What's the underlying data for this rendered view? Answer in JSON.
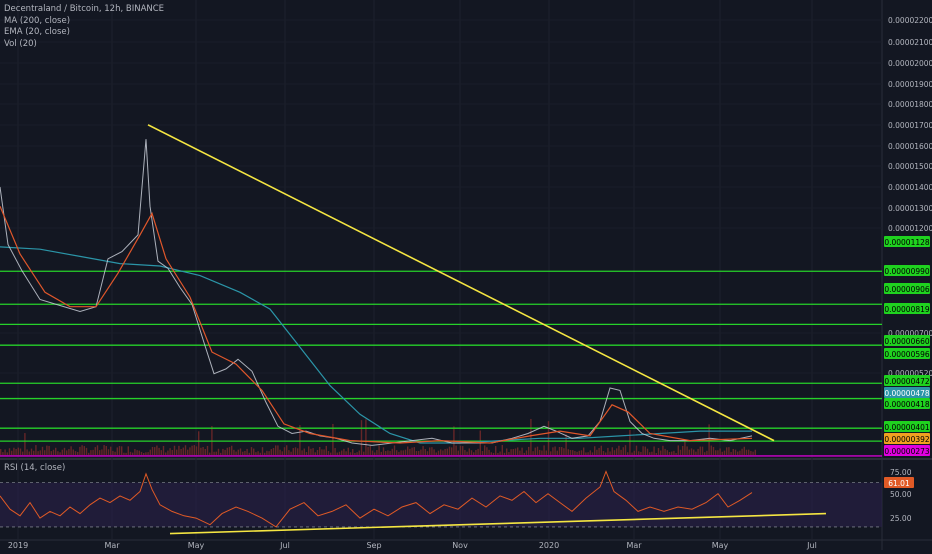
{
  "legend": {
    "title": "Decentraland / Bitcoin, 12h, BINANCE",
    "ma": "MA (200, close)",
    "ema": "EMA (20, close)",
    "vol": "Vol (20)",
    "rsi": "RSI (14, close)"
  },
  "colors": {
    "background": "#131722",
    "price_line": "#f2f2f2",
    "ema": "#e0572b",
    "ma": "#2b95a8",
    "trendline": "#f5e642",
    "support_lines": "#26d22a",
    "base_line": "#d000d0",
    "rsi_line": "#e05a26",
    "rsi_band": "#2a1f4a",
    "volume": "#7a2a2a"
  },
  "chart_data": [
    {
      "type": "line",
      "title": "Decentraland / Bitcoin, 12h, BINANCE",
      "x_tick_labels": [
        "2019",
        "Mar",
        "May",
        "Jul",
        "Sep",
        "Nov",
        "2020",
        "Mar",
        "May",
        "Jul"
      ],
      "y_tick_labels": [
        "0.00002200",
        "0.00002100",
        "0.00002000",
        "0.00001900",
        "0.00001800",
        "0.00001700",
        "0.00001600",
        "0.00001500",
        "0.00001400",
        "0.00001300",
        "0.00001200",
        "0.00000700",
        "0.00000520"
      ],
      "ylim": [
        3.6e-06,
        2.22e-05
      ],
      "price_path": [
        [
          0,
          1.48e-05
        ],
        [
          8,
          1.24e-05
        ],
        [
          22,
          1.13e-05
        ],
        [
          40,
          1.01e-05
        ],
        [
          60,
          9.85e-06
        ],
        [
          80,
          9.6e-06
        ],
        [
          96,
          9.8e-06
        ],
        [
          108,
          1.18e-05
        ],
        [
          122,
          1.21e-05
        ],
        [
          138,
          1.28e-05
        ],
        [
          146,
          1.68e-05
        ],
        [
          150,
          1.4e-05
        ],
        [
          158,
          1.17e-05
        ],
        [
          168,
          1.14e-05
        ],
        [
          180,
          1.06e-05
        ],
        [
          192,
          9.9e-06
        ],
        [
          204,
          8.3e-06
        ],
        [
          214,
          7e-06
        ],
        [
          226,
          7.2e-06
        ],
        [
          238,
          7.6e-06
        ],
        [
          252,
          7.1e-06
        ],
        [
          266,
          5.8e-06
        ],
        [
          278,
          4.8e-06
        ],
        [
          292,
          4.5e-06
        ],
        [
          306,
          4.6e-06
        ],
        [
          320,
          4.4e-06
        ],
        [
          336,
          4.3e-06
        ],
        [
          352,
          4.1e-06
        ],
        [
          372,
          4e-06
        ],
        [
          392,
          4.1e-06
        ],
        [
          412,
          4.2e-06
        ],
        [
          432,
          4.3e-06
        ],
        [
          452,
          4.1e-06
        ],
        [
          472,
          4.1e-06
        ],
        [
          492,
          4.1e-06
        ],
        [
          512,
          4.3e-06
        ],
        [
          528,
          4.5e-06
        ],
        [
          544,
          4.8e-06
        ],
        [
          556,
          4.6e-06
        ],
        [
          572,
          4.3e-06
        ],
        [
          588,
          4.4e-06
        ],
        [
          600,
          5e-06
        ],
        [
          610,
          6.4e-06
        ],
        [
          620,
          6.3e-06
        ],
        [
          630,
          5e-06
        ],
        [
          642,
          4.5e-06
        ],
        [
          654,
          4.3e-06
        ],
        [
          670,
          4.2e-06
        ],
        [
          690,
          4.2e-06
        ],
        [
          710,
          4.3e-06
        ],
        [
          730,
          4.2e-06
        ],
        [
          752,
          4.4e-06
        ]
      ],
      "ema_path": [
        [
          0,
          1.4e-05
        ],
        [
          20,
          1.2e-05
        ],
        [
          45,
          1.04e-05
        ],
        [
          70,
          9.8e-06
        ],
        [
          96,
          9.8e-06
        ],
        [
          118,
          1.12e-05
        ],
        [
          140,
          1.28e-05
        ],
        [
          152,
          1.37e-05
        ],
        [
          166,
          1.18e-05
        ],
        [
          190,
          1.02e-05
        ],
        [
          212,
          7.9e-06
        ],
        [
          236,
          7.4e-06
        ],
        [
          262,
          6.3e-06
        ],
        [
          284,
          4.9e-06
        ],
        [
          310,
          4.5e-06
        ],
        [
          350,
          4.2e-06
        ],
        [
          400,
          4.1e-06
        ],
        [
          440,
          4.2e-06
        ],
        [
          490,
          4.1e-06
        ],
        [
          530,
          4.4e-06
        ],
        [
          560,
          4.6e-06
        ],
        [
          590,
          4.4e-06
        ],
        [
          612,
          5.7e-06
        ],
        [
          628,
          5.4e-06
        ],
        [
          650,
          4.5e-06
        ],
        [
          690,
          4.2e-06
        ],
        [
          752,
          4.3e-06
        ]
      ],
      "ma_path": [
        [
          0,
          1.23e-05
        ],
        [
          40,
          1.22e-05
        ],
        [
          80,
          1.19e-05
        ],
        [
          120,
          1.16e-05
        ],
        [
          160,
          1.15e-05
        ],
        [
          200,
          1.11e-05
        ],
        [
          240,
          1.04e-05
        ],
        [
          270,
          9.7e-06
        ],
        [
          300,
          8.1e-06
        ],
        [
          330,
          6.5e-06
        ],
        [
          360,
          5.3e-06
        ],
        [
          390,
          4.5e-06
        ],
        [
          420,
          4.1e-06
        ],
        [
          460,
          4.1e-06
        ],
        [
          500,
          4.2e-06
        ],
        [
          540,
          4.3e-06
        ],
        [
          580,
          4.3e-06
        ],
        [
          620,
          4.4e-06
        ],
        [
          660,
          4.5e-06
        ],
        [
          700,
          4.6e-06
        ],
        [
          752,
          4.6e-06
        ]
      ],
      "trendline": [
        [
          148,
          1.74e-05
        ],
        [
          774,
          4.2e-06
        ]
      ],
      "horizontal_levels": [
        1.128e-05,
        9.9e-06,
        9.06e-06,
        8.19e-06,
        6.6e-06,
        5.96e-06,
        4.72e-06,
        4.18e-06
      ],
      "base_level": 3.56e-06,
      "price_labels": [
        {
          "text": "0.00001128",
          "kind": "level"
        },
        {
          "text": "0.00000990",
          "kind": "level"
        },
        {
          "text": "0.00000906",
          "kind": "level"
        },
        {
          "text": "0.00000819",
          "kind": "level"
        },
        {
          "text": "0.00000660",
          "kind": "level"
        },
        {
          "text": "0.00000596",
          "kind": "level"
        },
        {
          "text": "0.00000472",
          "kind": "level"
        },
        {
          "text": "0.00000478",
          "kind": "ma"
        },
        {
          "text": "0.00000418",
          "kind": "level"
        },
        {
          "text": "0.00000401",
          "kind": "level"
        },
        {
          "text": "0.00000392",
          "kind": "ema"
        },
        {
          "text": "0.00000273",
          "kind": "base"
        }
      ]
    },
    {
      "type": "line",
      "title": "RSI (14, close)",
      "y_tick_labels": [
        "75.00",
        "50.00",
        "25.00"
      ],
      "ylim": [
        20,
        85
      ],
      "bands": [
        30,
        70
      ],
      "last_value_label": "61.01",
      "rsi_path": [
        [
          0,
          58
        ],
        [
          10,
          46
        ],
        [
          20,
          40
        ],
        [
          30,
          52
        ],
        [
          40,
          38
        ],
        [
          50,
          44
        ],
        [
          60,
          40
        ],
        [
          70,
          48
        ],
        [
          80,
          42
        ],
        [
          90,
          50
        ],
        [
          100,
          56
        ],
        [
          110,
          52
        ],
        [
          120,
          58
        ],
        [
          130,
          54
        ],
        [
          140,
          62
        ],
        [
          146,
          78
        ],
        [
          152,
          64
        ],
        [
          160,
          50
        ],
        [
          172,
          44
        ],
        [
          184,
          40
        ],
        [
          196,
          38
        ],
        [
          210,
          32
        ],
        [
          222,
          42
        ],
        [
          236,
          48
        ],
        [
          248,
          44
        ],
        [
          262,
          38
        ],
        [
          276,
          30
        ],
        [
          290,
          46
        ],
        [
          304,
          52
        ],
        [
          318,
          40
        ],
        [
          332,
          44
        ],
        [
          346,
          50
        ],
        [
          360,
          38
        ],
        [
          374,
          46
        ],
        [
          388,
          40
        ],
        [
          402,
          48
        ],
        [
          416,
          52
        ],
        [
          430,
          42
        ],
        [
          444,
          50
        ],
        [
          458,
          46
        ],
        [
          472,
          56
        ],
        [
          486,
          48
        ],
        [
          500,
          58
        ],
        [
          512,
          54
        ],
        [
          524,
          62
        ],
        [
          536,
          52
        ],
        [
          548,
          60
        ],
        [
          560,
          52
        ],
        [
          572,
          44
        ],
        [
          586,
          56
        ],
        [
          600,
          66
        ],
        [
          606,
          80
        ],
        [
          614,
          62
        ],
        [
          626,
          54
        ],
        [
          638,
          44
        ],
        [
          650,
          48
        ],
        [
          664,
          44
        ],
        [
          678,
          48
        ],
        [
          692,
          46
        ],
        [
          706,
          52
        ],
        [
          718,
          60
        ],
        [
          728,
          48
        ],
        [
          740,
          54
        ],
        [
          752,
          61
        ]
      ],
      "trendline": [
        [
          170,
          24
        ],
        [
          826,
          42
        ]
      ]
    }
  ]
}
